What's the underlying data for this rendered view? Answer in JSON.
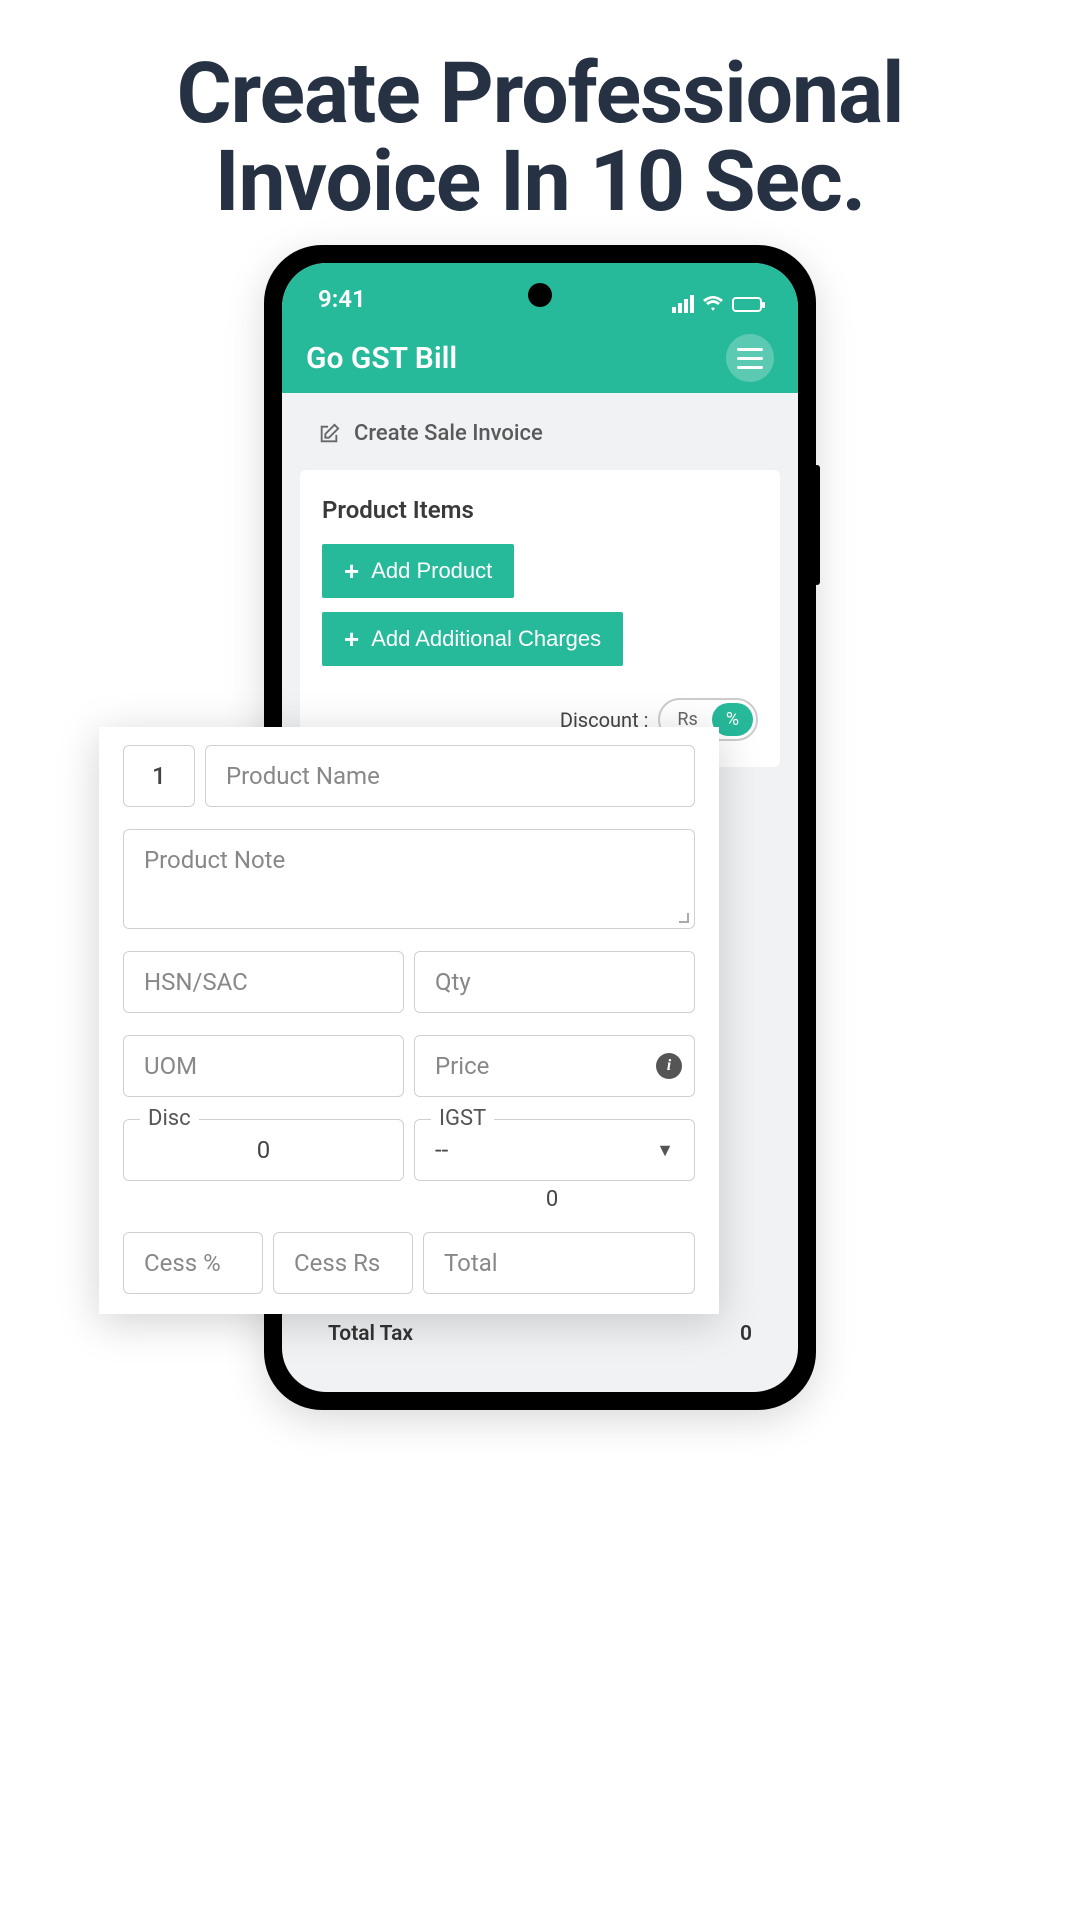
{
  "headline_line1": "Create Professional",
  "headline_line2": "Invoice In 10 Sec.",
  "status": {
    "time": "9:41"
  },
  "header": {
    "title": "Go GST Bill"
  },
  "page": {
    "subtitle": "Create Sale Invoice"
  },
  "card": {
    "title": "Product Items",
    "add_product": "Add Product",
    "add_charges": "Add Additional Charges",
    "discount_label": "Discount :",
    "discount_rs": "Rs",
    "discount_pct": "%"
  },
  "form": {
    "index": "1",
    "product_name": "Product Name",
    "product_note": "Product Note",
    "hsn": "HSN/SAC",
    "qty": "Qty",
    "uom": "UOM",
    "price": "Price",
    "disc_label": "Disc",
    "disc_value": "0",
    "igst_label": "IGST",
    "igst_value": "--",
    "igst_under": "0",
    "cess_pct": "Cess %",
    "cess_rs": "Cess Rs",
    "total": "Total"
  },
  "footer": {
    "total_tax_label": "Total Tax",
    "total_tax_value": "0"
  }
}
